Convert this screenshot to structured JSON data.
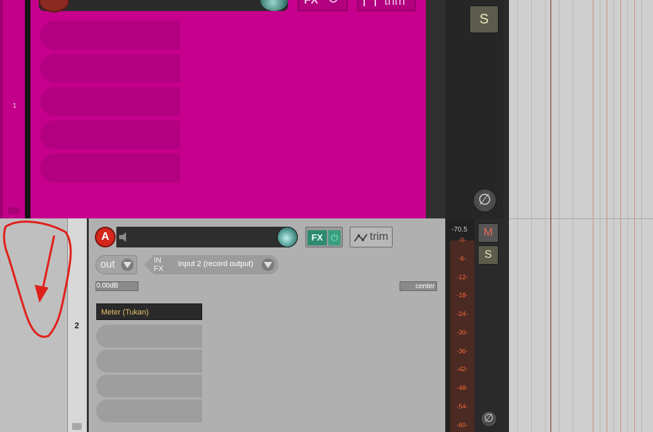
{
  "track1": {
    "number": "1",
    "fx_label": "FX",
    "trim_label": "trim",
    "solo_label": "S",
    "phase_symbol": "∅",
    "color": "#c6008c"
  },
  "track2": {
    "number": "2",
    "record_arm_label": "A",
    "fx_label": "FX",
    "fx_power_symbol": "⏻",
    "trim_label": "trim",
    "output_label": "out",
    "input_fx_label_top": "IN",
    "input_fx_label_bottom": "FX",
    "input_route": "Input 2 (record output)",
    "volume": "0.00dB",
    "pan": "center",
    "fx_chain": [
      "Meter (Tukan)"
    ],
    "empty_slots": 4
  },
  "meter": {
    "peak": "-70.5",
    "ticks": [
      "-0-",
      "-6-",
      "-12-",
      "-18-",
      "-24-",
      "-30-",
      "-36-",
      "-42-",
      "-48-",
      "-54-",
      "-60-"
    ]
  },
  "mixer2": {
    "mute_label": "M",
    "solo_label": "S",
    "phase_symbol": "∅"
  },
  "colors": {
    "record_arm": "#d4261c",
    "fx_active": "#2e8a6e",
    "meter_text": "#ff6a3c",
    "annotation": "#e0201a"
  }
}
